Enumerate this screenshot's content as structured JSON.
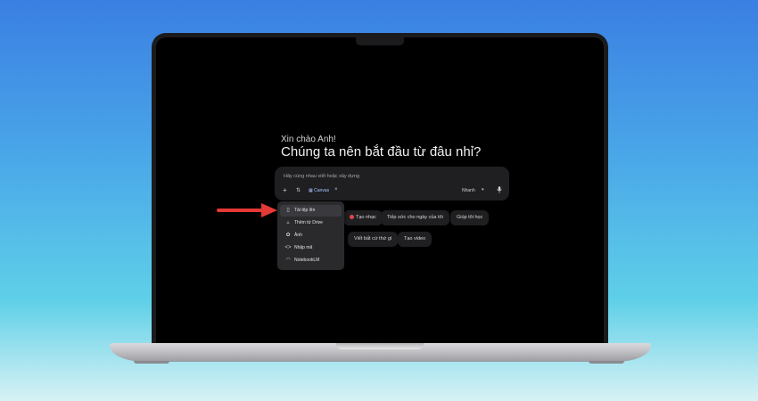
{
  "greeting": "Xin chào Anh!",
  "headline": "Chúng ta nên bắt đầu từ đâu nhỉ?",
  "prompt": {
    "placeholder": "Hãy cùng nhau viết hoặc xây dựng",
    "canvas_label": "Canvas",
    "model_label": "Nhanh"
  },
  "icons": {
    "plus": "+",
    "tools": "⇅",
    "canvas": "▦",
    "close": "×",
    "caret": "▾",
    "mic": "🎙",
    "upload": "▯",
    "drive": "▵",
    "photo": "✿",
    "code": "<>",
    "notebook": "◠"
  },
  "menu": [
    {
      "label": "Tải tệp lên",
      "icon": "upload-icon"
    },
    {
      "label": "Thêm từ Drive",
      "icon": "drive-icon"
    },
    {
      "label": "Ảnh",
      "icon": "photo-icon"
    },
    {
      "label": "Nhập mã",
      "icon": "code-icon"
    },
    {
      "label": "NotebookLM",
      "icon": "notebook-icon"
    }
  ],
  "chips": {
    "music": "Tạo nhạc",
    "tips": "Tiếp sức cho ngày của tôi",
    "learn": "Giúp tôi học",
    "write": "Viết bất cứ thứ gì",
    "video": "Tạo video"
  },
  "colors": {
    "accent_arrow": "#e53935",
    "screen_bg": "#000000",
    "surface": "#1f1f21",
    "menu_bg": "#2a2a2d"
  }
}
